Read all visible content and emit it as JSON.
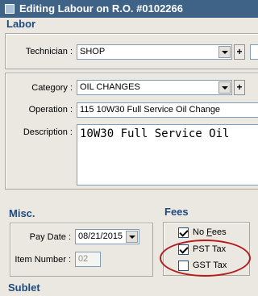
{
  "window": {
    "title": "Editing Labour on R.O. #0102266"
  },
  "labor": {
    "title": "Labor",
    "technician_label": "Technician :",
    "technician_value": "SHOP",
    "category_label": "Category :",
    "category_value": "OIL CHANGES",
    "operation_label": "Operation :",
    "operation_value": "115  10W30 Full Service Oil Change",
    "description_label": "Description :",
    "description_value": "10W30 Full Service Oil",
    "plus_label": "+"
  },
  "misc": {
    "title": "Misc.",
    "pay_date_label": "Pay Date :",
    "pay_date_value": "08/21/2015",
    "item_number_label": "Item Number :",
    "item_number_value": "02"
  },
  "fees": {
    "title": "Fees",
    "items": [
      {
        "label_prefix": "No ",
        "label_accel": "F",
        "label_rest": "ees",
        "checked": true
      },
      {
        "label": "PST Tax",
        "checked": true
      },
      {
        "label": "GST Tax",
        "checked": false
      }
    ]
  },
  "sublet": {
    "title": "Sublet"
  },
  "colors": {
    "titlebar": "#3f6386",
    "section_title": "#1f4a7d",
    "highlight_oval": "#b21c1c"
  }
}
